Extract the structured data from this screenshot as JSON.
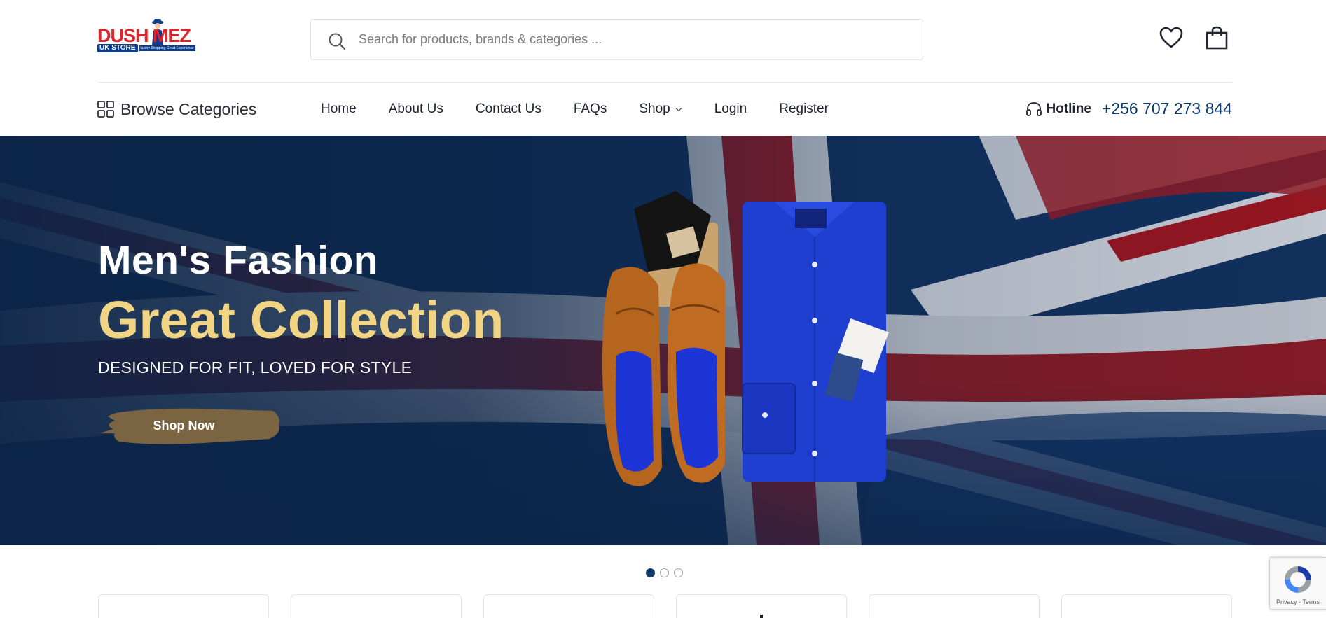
{
  "brand": {
    "logo_top": "DUSH MEZ",
    "logo_uk": "UK STORE",
    "logo_tagline": "luxury Shopping Great Experience"
  },
  "search": {
    "placeholder": "Search for products, brands & categories ..."
  },
  "header_icons": {
    "wishlist": "heart-icon",
    "cart": "shopping-bag-icon"
  },
  "nav": {
    "browse_label": "Browse Categories",
    "items": [
      {
        "label": "Home"
      },
      {
        "label": "About Us"
      },
      {
        "label": "Contact Us"
      },
      {
        "label": "FAQs"
      },
      {
        "label": "Shop",
        "has_dropdown": true
      },
      {
        "label": "Login"
      },
      {
        "label": "Register"
      }
    ],
    "hotline_label": "Hotline",
    "hotline_phone": "+256 707 273 844"
  },
  "hero": {
    "title": "Men's Fashion",
    "headline": "Great Collection",
    "subtitle": "DESIGNED FOR FIT, LOVED FOR STYLE",
    "cta_label": "Shop Now",
    "colors": {
      "headline": "#f1d584",
      "cta_brush": "#7a6442",
      "flag_blue": "#0e2b52",
      "flag_red": "#a3141c"
    }
  },
  "carousel": {
    "slide_count": 3,
    "active_slide": 1
  },
  "recaptcha": {
    "links": "Privacy - Terms"
  },
  "colors": {
    "accent": "#0c3b6b",
    "brand_red": "#e0242b",
    "brand_blue": "#0b3d91"
  }
}
